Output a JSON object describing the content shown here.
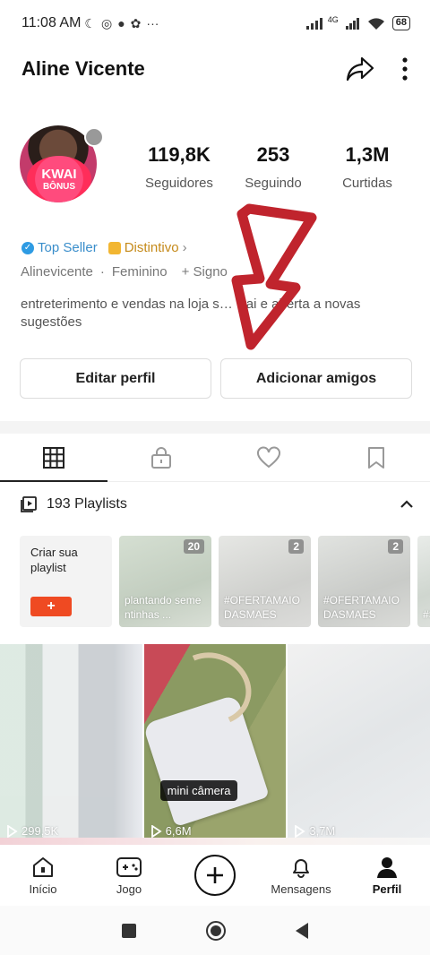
{
  "status_bar": {
    "time": "11:08 AM",
    "network": "4G",
    "battery": "68"
  },
  "header": {
    "title": "Aline Vicente"
  },
  "profile": {
    "avatar_badge_line1": "KWAI",
    "avatar_badge_line2": "BÔNUS",
    "stats": [
      {
        "value": "119,8K",
        "label": "Seguidores"
      },
      {
        "value": "253",
        "label": "Seguindo"
      },
      {
        "value": "1,3M",
        "label": "Curtidas"
      }
    ],
    "badge_top_seller": "Top Seller",
    "badge_distintivo": "Distintivo",
    "handle": "Alinevicente",
    "gender": "Feminino",
    "sign": "+ Signo",
    "bio": "entreterimento e vendas na loja s… wai e aberta a novas sugestões"
  },
  "actions": {
    "edit_label": "Editar perfil",
    "add_label": "Adicionar amigos"
  },
  "tabs": [
    "grid-icon",
    "lock-icon",
    "heart-icon",
    "bookmark-icon"
  ],
  "playlists": {
    "header": "193 Playlists",
    "create_label": "Criar sua playlist",
    "create_btn": "+",
    "items": [
      {
        "count": "20",
        "title": "plantando sementinhas ..."
      },
      {
        "count": "2",
        "title": "#OFERTAMAIO DASMAES"
      },
      {
        "count": "2",
        "title": "#OFERTAMAIO DASMAES"
      },
      {
        "count": "",
        "title": "#S"
      }
    ]
  },
  "videos": [
    {
      "views": "299,5K"
    },
    {
      "views": "6,6M",
      "label": "mini câmera"
    },
    {
      "views": "3,7M"
    }
  ],
  "bottom_nav": [
    {
      "label": "Início",
      "icon": "home-icon"
    },
    {
      "label": "Jogo",
      "icon": "game-icon"
    },
    {
      "label": "",
      "icon": "plus-icon"
    },
    {
      "label": "Mensagens",
      "icon": "bell-icon"
    },
    {
      "label": "Perfil",
      "icon": "profile-icon"
    }
  ],
  "colors": {
    "accent": "#ef4a22",
    "annotation": "#c0242d",
    "top_seller": "#2e9be3",
    "distintivo": "#c58a1a"
  }
}
